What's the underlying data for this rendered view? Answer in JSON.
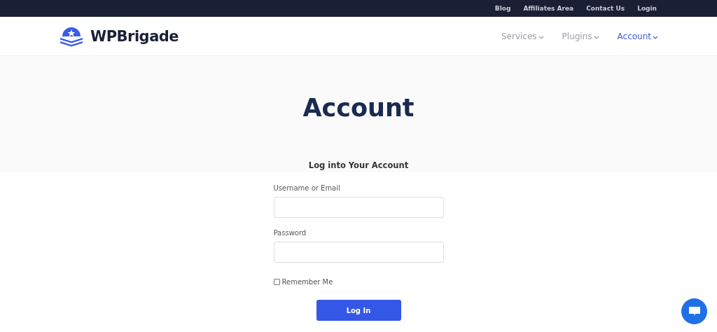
{
  "top_links": [
    "Blog",
    "Affiliates Area",
    "Contact Us",
    "Login"
  ],
  "logo": {
    "text": "WPBrigade"
  },
  "nav": [
    {
      "label": "Services",
      "selected": false
    },
    {
      "label": "Plugins",
      "selected": false
    },
    {
      "label": "Account",
      "selected": true
    }
  ],
  "page_title": "Account",
  "form": {
    "title": "Log into Your Account",
    "fields": [
      {
        "label": "Username or Email"
      },
      {
        "label": "Password"
      }
    ],
    "remember": {
      "label": "Remember Me",
      "checked": false
    },
    "button": "Log In"
  }
}
